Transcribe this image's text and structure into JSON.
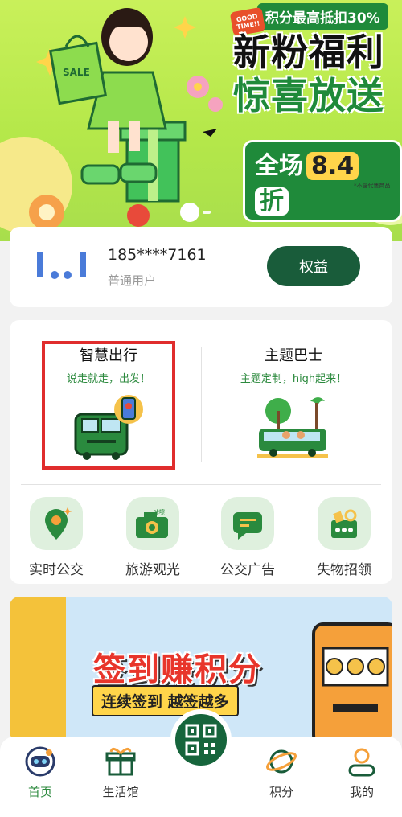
{
  "banner": {
    "promo_text": "积分最高抵扣30%",
    "badge_text": "GOOD TIME!!",
    "title_line1": "新粉福利",
    "title_line2": "惊喜放送",
    "sale_prefix": "全场",
    "sale_number": "8.4",
    "sale_suffix": "折",
    "note": "*不含代售商品",
    "bag_text": "SALE"
  },
  "user": {
    "phone": "185****7161",
    "level": "普通用户",
    "rights_button": "权益"
  },
  "features": [
    {
      "title": "智慧出行",
      "subtitle": "说走就走，出发！"
    },
    {
      "title": "主题巴士",
      "subtitle": "主题定制，high起来！"
    }
  ],
  "quick_items": [
    {
      "label": "实时公交",
      "icon": "location-pin-icon"
    },
    {
      "label": "旅游观光",
      "icon": "camera-icon",
      "tag": "咔嚓!"
    },
    {
      "label": "公交广告",
      "icon": "chat-ad-icon"
    },
    {
      "label": "失物招领",
      "icon": "lost-found-icon"
    }
  ],
  "promo": {
    "title": "签到赚积分",
    "subtitle": "连续签到 越签越多"
  },
  "tabs": [
    {
      "label": "首页",
      "icon": "astronaut-home-icon",
      "active": true
    },
    {
      "label": "生活馆",
      "icon": "gift-icon",
      "active": false
    },
    {
      "label": "积分",
      "icon": "planet-icon",
      "active": false
    },
    {
      "label": "我的",
      "icon": "person-icon",
      "active": false
    }
  ],
  "center_tab": {
    "icon": "qr-code-icon"
  },
  "colors": {
    "brand_green": "#195c3a",
    "accent_green": "#2c8a3e",
    "highlight_red": "#e02d2d"
  }
}
